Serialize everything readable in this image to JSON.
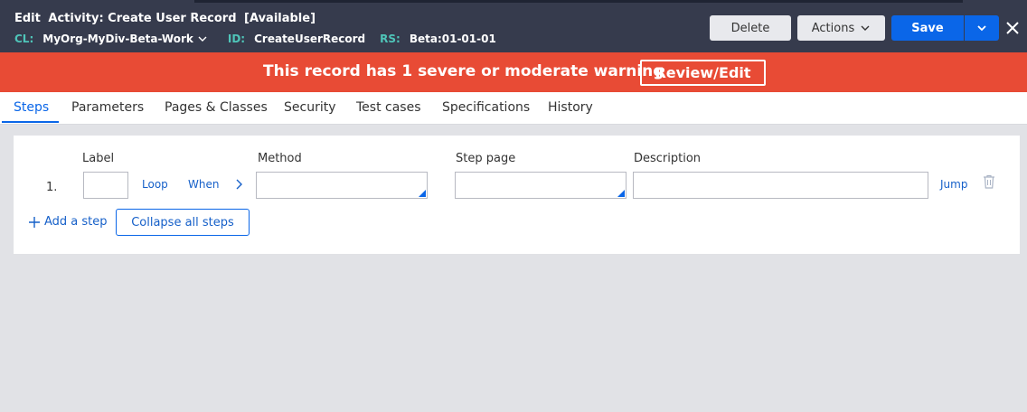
{
  "header": {
    "edit_label": "Edit",
    "title": "Activity: Create User Record",
    "status": "[Available]",
    "meta": {
      "cl_key": "CL:",
      "cl_value": "MyOrg-MyDiv-Beta-Work",
      "id_key": "ID:",
      "id_value": "CreateUserRecord",
      "rs_key": "RS:",
      "rs_value": "Beta:01-01-01"
    },
    "delete_label": "Delete",
    "actions_label": "Actions",
    "save_label": "Save",
    "icons": {
      "cl_dropdown": "chevron-down-icon",
      "actions_dropdown": "chevron-down-icon",
      "save_menu": "chevron-down-icon",
      "close": "close-icon"
    }
  },
  "warning": {
    "message": "This record has 1 severe or moderate warning",
    "review_label": "Review/Edit"
  },
  "tabs": [
    {
      "label": "Steps",
      "active": true
    },
    {
      "label": "Parameters"
    },
    {
      "label": "Pages & Classes"
    },
    {
      "label": "Security"
    },
    {
      "label": "Test cases"
    },
    {
      "label": "Specifications"
    },
    {
      "label": "History"
    }
  ],
  "steps": {
    "columns": {
      "label": "Label",
      "method": "Method",
      "step_page": "Step page",
      "description": "Description"
    },
    "rows": [
      {
        "number": "1.",
        "label_value": "",
        "loop_label": "Loop",
        "when_label": "When",
        "method_value": "",
        "step_page_value": "",
        "description_value": "",
        "jump_label": "Jump"
      }
    ],
    "add_step_label": "Add a step",
    "collapse_label": "Collapse all steps",
    "icons": {
      "expand": "chevron-right-icon",
      "delete": "trash-icon",
      "add": "plus-icon"
    }
  },
  "colors": {
    "header_bg": "#363b4d",
    "meta_key": "#4fc5b9",
    "warning_bg": "#e84b35",
    "primary": "#0a66e8",
    "link": "#1660c9",
    "page_bg": "#e1e2e6"
  }
}
